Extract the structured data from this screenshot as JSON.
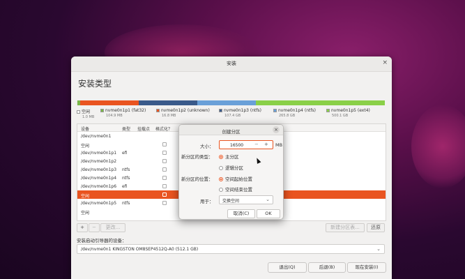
{
  "window": {
    "title": "安装",
    "close_icon": "×"
  },
  "heading": "安装类型",
  "partitions_bar": [
    {
      "color": "#e8e8e8",
      "fraction": 0.003
    },
    {
      "color": "#7ab648",
      "fraction": 0.008
    },
    {
      "color": "#e95420",
      "fraction": 0.19
    },
    {
      "color": "#3a5a8a",
      "fraction": 0.19
    },
    {
      "color": "#6aa0d8",
      "fraction": 0.19
    },
    {
      "color": "#8ad048",
      "fraction": 0.419
    }
  ],
  "legend": [
    {
      "label": "空闲",
      "size": "1.0 MB",
      "color": "#ffffff"
    },
    {
      "label": "nvme0n1p1 (fat32)",
      "size": "104.9 MB",
      "color": "#7ab648"
    },
    {
      "label": "nvme0n1p2 (unknown)",
      "size": "16.8 MB",
      "color": "#e95420"
    },
    {
      "label": "nvme0n1p3 (ntfs)",
      "size": "107.4 GB",
      "color": "#3a5a8a"
    },
    {
      "label": "nvme0n1p4 (ntfs)",
      "size": "265.8 GB",
      "color": "#6aa0d8"
    },
    {
      "label": "nvme0n1p5 (ext4)",
      "size": "500.1 GB",
      "color": "#8ad048"
    }
  ],
  "table": {
    "headers": {
      "device": "设备",
      "type": "类型",
      "mount": "挂载点",
      "format": "格式化？"
    },
    "rows": [
      {
        "device": "/dev/nvme0n1",
        "type": "",
        "checkbox": false
      },
      {
        "device": "空闲",
        "type": "",
        "checkbox": true
      },
      {
        "device": "/dev/nvme0n1p1",
        "type": "efi",
        "checkbox": true
      },
      {
        "device": "/dev/nvme0n1p2",
        "type": "",
        "checkbox": true
      },
      {
        "device": "/dev/nvme0n1p3",
        "type": "ntfs",
        "checkbox": true
      },
      {
        "device": "/dev/nvme0n1p4",
        "type": "ntfs",
        "checkbox": true
      },
      {
        "device": "/dev/nvme0n1p6",
        "type": "efi",
        "checkbox": true
      },
      {
        "device": "空闲",
        "type": "",
        "checkbox": true,
        "selected": true
      },
      {
        "device": "/dev/nvme0n1p5",
        "type": "ntfs",
        "checkbox": true
      },
      {
        "device": "空闲",
        "type": "",
        "checkbox": false
      }
    ]
  },
  "toolbar": {
    "add": "+",
    "minus": "−",
    "change": "更改...",
    "new_table": "新建分区表...",
    "revert": "还原"
  },
  "boot": {
    "label": "安装启动引导器的设备：",
    "value": "/dev/nvme0n1    KINGSTON OM8SEP4512Q-A0 (512.1 GB)",
    "arrow": "⌄"
  },
  "footer": {
    "quit": "退出(Q)",
    "back": "后退(B)",
    "install": "现在安装(I)"
  },
  "dialog": {
    "title": "创建分区",
    "close_icon": "×",
    "size_label": "大小：",
    "size_value": "16500",
    "size_unit": "MB",
    "minus": "−",
    "plus": "+",
    "type_label": "新分区的类型：",
    "type_primary": "主分区",
    "type_logical": "逻辑分区",
    "loc_label": "新分区的位置：",
    "loc_start": "空间起始位置",
    "loc_end": "空间结束位置",
    "use_label": "用于：",
    "use_value": "交换空间",
    "arrow": "⌄",
    "cancel": "取消(C)",
    "ok": "OK"
  }
}
